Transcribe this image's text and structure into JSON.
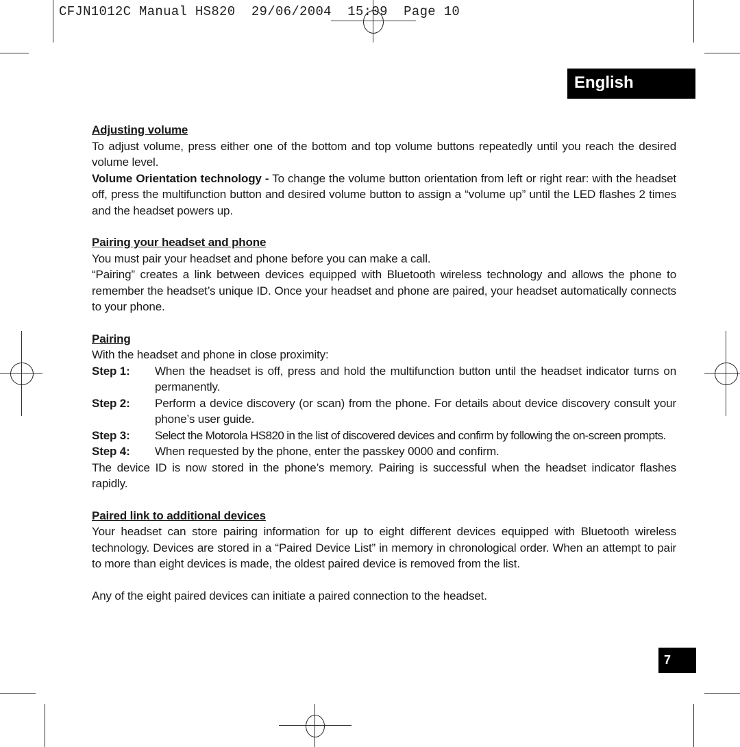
{
  "print_slug": "CFJN1012C Manual HS820  29/06/2004  15:09  Page 10",
  "language_tab": "English",
  "sections": {
    "adjusting_volume": {
      "heading": "Adjusting volume",
      "para1": "To adjust volume, press either one of the bottom and top volume buttons repeatedly until you reach the desired volume level.",
      "para2_bold": "Volume Orientation technology -",
      "para2": " To change the volume button orientation from left or right rear: with the headset off, press the multifunction button and desired volume button to assign a “volume up” until the LED flashes 2 times and the headset powers up."
    },
    "pairing_headset_phone": {
      "heading": "Pairing your headset and phone",
      "para1": "You must pair your headset and phone before you can make a call.",
      "para2": "“Pairing” creates a link between devices equipped with Bluetooth wireless technology and allows the phone to remember the headset’s unique ID. Once your headset and phone are paired, your headset automatically connects to your phone."
    },
    "pairing": {
      "heading": "Pairing",
      "intro": "With the headset and phone in close proximity:",
      "steps": [
        {
          "label": "Step 1:",
          "text": "When the headset is off, press and hold the multifunction button until the headset indicator turns on permanently."
        },
        {
          "label": "Step 2:",
          "text": "Perform a device discovery (or scan) from the phone. For details about device discovery consult your phone’s user guide."
        },
        {
          "label": "Step 3:",
          "text": "Select the Motorola HS820 in the list of discovered devices and confirm by following the on-screen prompts."
        },
        {
          "label": "Step 4:",
          "text": "When requested by the phone, enter the passkey 0000 and confirm."
        }
      ],
      "outro": "The device ID is now stored in the phone’s memory. Pairing is successful when the headset indicator flashes rapidly."
    },
    "paired_link": {
      "heading": "Paired link to additional devices",
      "para1": "Your headset can store pairing information for up to eight different devices equipped with Bluetooth wireless technology. Devices are stored in a “Paired Device List” in memory in chronological order. When an attempt to pair to more than eight devices is made, the oldest paired device is removed from the list.",
      "para2": "Any of the eight paired devices can initiate a paired connection to the headset."
    }
  },
  "page_number": "7"
}
